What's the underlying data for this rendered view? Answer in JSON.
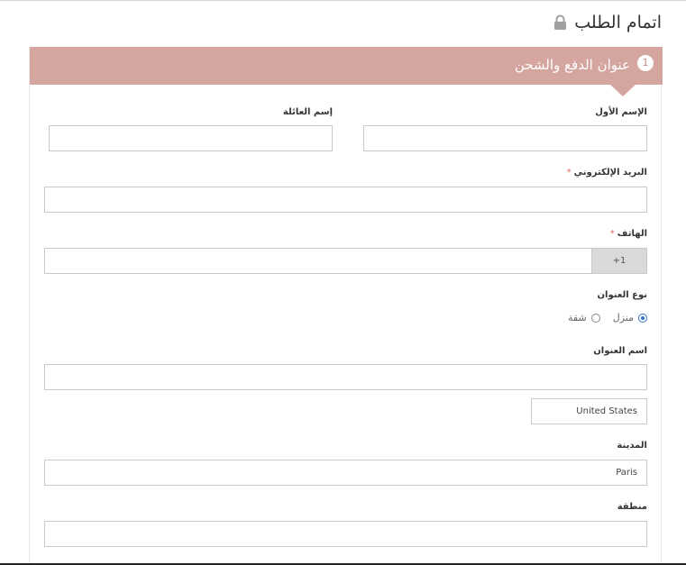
{
  "page": {
    "title": "اتمام الطلب",
    "lock_icon": "lock-icon"
  },
  "step": {
    "number": "1",
    "title": "عنوان الدفع والشحن"
  },
  "form": {
    "first_name": {
      "label": "الإسم الأول",
      "value": ""
    },
    "last_name": {
      "label": "إسم العائلة",
      "value": ""
    },
    "email": {
      "label": "البريد الإلكتروني",
      "required_mark": "*",
      "value": ""
    },
    "phone": {
      "label": "الهاتف",
      "required_mark": "*",
      "prefix": "+1",
      "value": ""
    },
    "address_type": {
      "label": "نوع العنوان",
      "options": [
        "منزل",
        "شقة"
      ],
      "selected": "منزل"
    },
    "address_name": {
      "label": "اسم العنوان",
      "value": ""
    },
    "country": {
      "value": "United States"
    },
    "city": {
      "label": "المدينة",
      "value": "Paris"
    },
    "region": {
      "label": "منطقة",
      "value": ""
    }
  },
  "colors": {
    "step_bar": "#d5a6a0",
    "radio_accent": "#2e6fd0",
    "required": "#e06a5a"
  }
}
